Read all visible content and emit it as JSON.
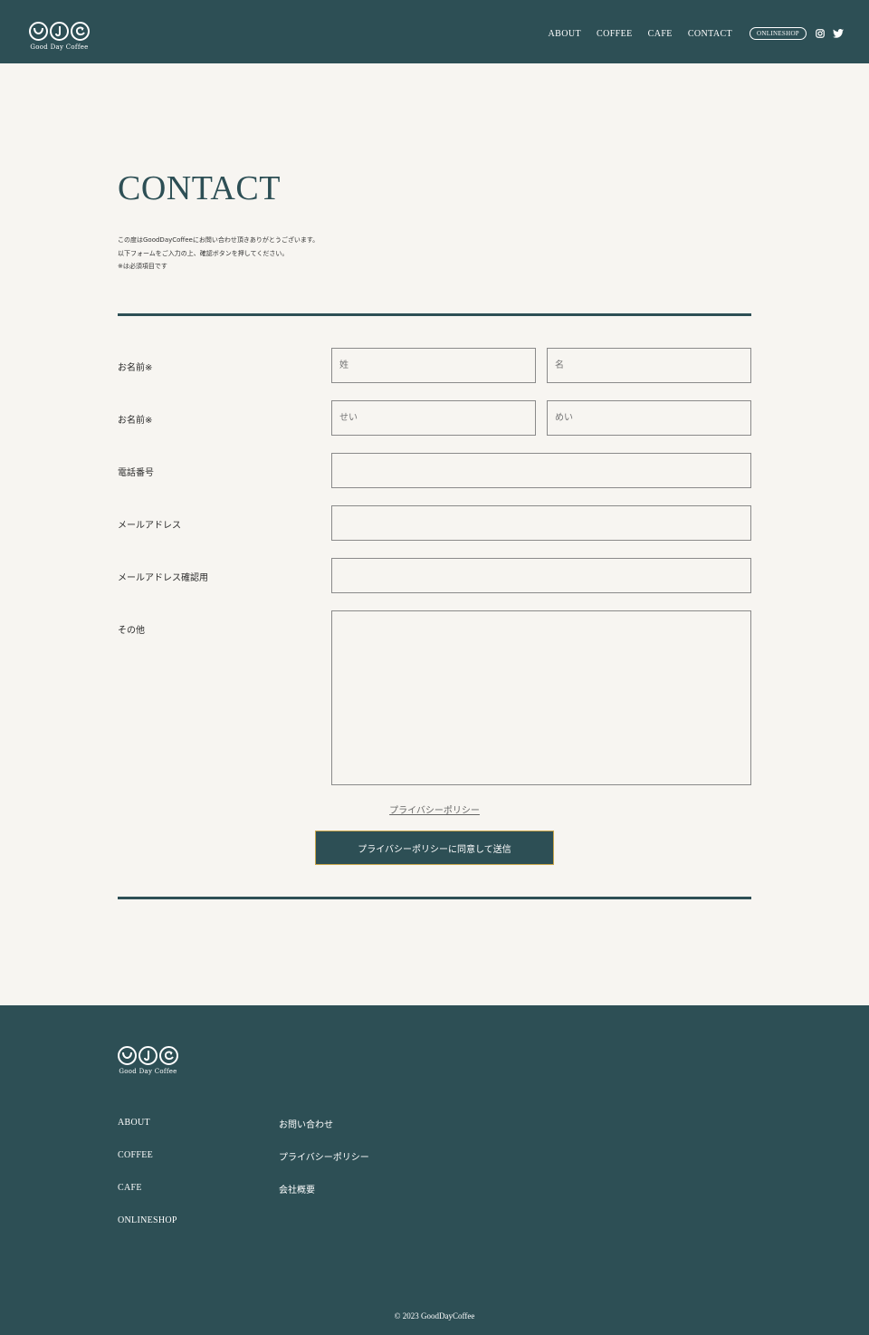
{
  "brand": {
    "name": "Good Day Coffee"
  },
  "nav": {
    "items": [
      {
        "label": "ABOUT"
      },
      {
        "label": "COFFEE"
      },
      {
        "label": "CAFE"
      },
      {
        "label": "CONTACT"
      }
    ],
    "shop_label": "ONLINESHOP",
    "sns": [
      "instagram-icon",
      "twitter-icon"
    ]
  },
  "contact": {
    "title": "CONTACT",
    "intro": [
      "この度はGoodDayCoffeeにお問い合わせ頂きありがとうございます。",
      "以下フォームをご入力の上、確認ボタンを押してください。",
      "※は必須項目です"
    ]
  },
  "form": {
    "name_label": "お名前※",
    "last_name_placeholder": "姓",
    "first_name_placeholder": "名",
    "kana_label": "お名前※",
    "last_kana_placeholder": "せい",
    "first_kana_placeholder": "めい",
    "phone_label": "電話番号",
    "email_label": "メールアドレス",
    "email_confirm_label": "メールアドレス確認用",
    "other_label": "その他",
    "privacy_link": "プライバシーポリシー",
    "submit_label": "プライバシーポリシーに同意して送信"
  },
  "footer": {
    "col1": [
      "ABOUT",
      "COFFEE",
      "CAFE",
      "ONLINESHOP"
    ],
    "col2": [
      "お問い合わせ",
      "プライバシーポリシー",
      "会社概要"
    ],
    "copyright": "© 2023 GoodDayCoffee"
  },
  "colors": {
    "primary": "#2d4f55",
    "background": "#f7f5f1",
    "accent_border": "#c9a64b"
  }
}
